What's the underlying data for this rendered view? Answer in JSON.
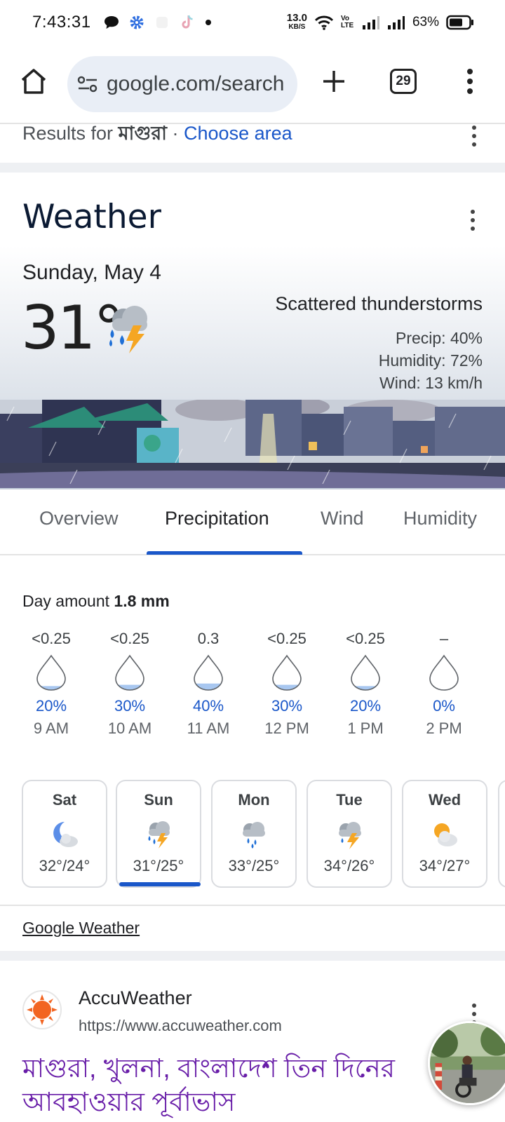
{
  "status_bar": {
    "time": "7:43:31",
    "speed_value": "13.0",
    "speed_unit": "KB/S",
    "volte": "Vo LTE",
    "battery_pct": "63%"
  },
  "browser": {
    "url": "google.com/search",
    "tab_count": "29"
  },
  "results_for": {
    "prefix": "Results for",
    "location": "মাগুরা",
    "separator": " · ",
    "choose_area": "Choose area"
  },
  "weather": {
    "title": "Weather",
    "date": "Sunday, May 4",
    "temperature": "31°",
    "condition": "Scattered thunderstorms",
    "precip": "Precip: 40%",
    "humidity": "Humidity: 72%",
    "wind": "Wind: 13 km/h",
    "tabs": [
      {
        "label": "Overview"
      },
      {
        "label": "Precipitation"
      },
      {
        "label": "Wind"
      },
      {
        "label": "Humidity"
      }
    ],
    "day_amount_label": "Day amount",
    "day_amount_value": "1.8 mm",
    "hours": [
      {
        "amount": "<0.25",
        "percent": "20%",
        "time": "9 AM",
        "fill": 0.2
      },
      {
        "amount": "<0.25",
        "percent": "30%",
        "time": "10 AM",
        "fill": 0.3
      },
      {
        "amount": "0.3",
        "percent": "40%",
        "time": "11 AM",
        "fill": 0.4
      },
      {
        "amount": "<0.25",
        "percent": "30%",
        "time": "12 PM",
        "fill": 0.3
      },
      {
        "amount": "<0.25",
        "percent": "20%",
        "time": "1 PM",
        "fill": 0.2
      },
      {
        "amount": "–",
        "percent": "0%",
        "time": "2 PM",
        "fill": 0.0
      }
    ],
    "days": [
      {
        "name": "Sat",
        "temps": "32°/24°",
        "icon": "partly-cloudy-night-icon"
      },
      {
        "name": "Sun",
        "temps": "31°/25°",
        "icon": "thunderstorm-rain-icon"
      },
      {
        "name": "Mon",
        "temps": "33°/25°",
        "icon": "rain-showers-icon"
      },
      {
        "name": "Tue",
        "temps": "34°/26°",
        "icon": "thunderstorm-icon"
      },
      {
        "name": "Wed",
        "temps": "34°/27°",
        "icon": "partly-cloudy-icon"
      }
    ],
    "source_link": "Google Weather"
  },
  "accuweather": {
    "name": "AccuWeather",
    "url": "https://www.accuweather.com",
    "heading": "মাগুরা, খুলনা, বাংলাদেশ তিন দিনের আবহাওয়ার পূর্বাভাস"
  },
  "colors": {
    "accent_blue": "#1a57c9",
    "visited_link": "#681da8",
    "url_pill": "#e9eef6"
  }
}
